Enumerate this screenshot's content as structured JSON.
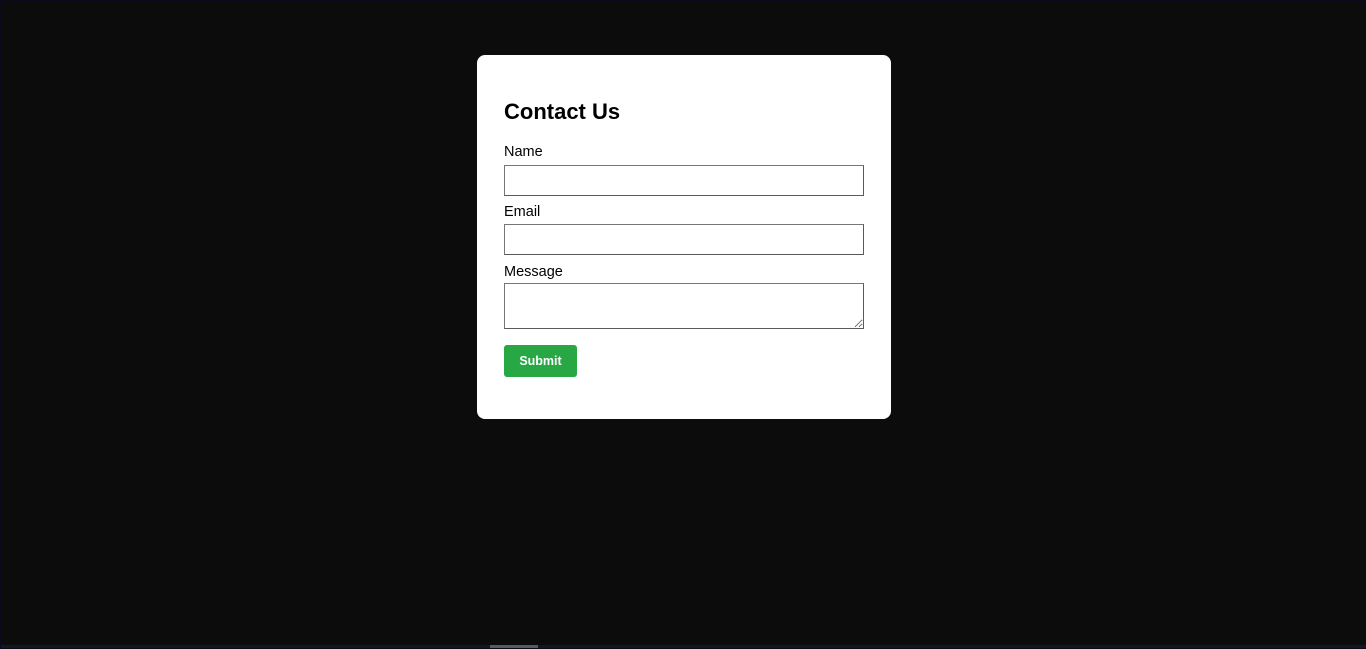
{
  "form": {
    "title": "Contact Us",
    "name_label": "Name",
    "name_value": "",
    "email_label": "Email",
    "email_value": "",
    "message_label": "Message",
    "message_value": "",
    "submit_label": "Submit"
  },
  "colors": {
    "page_background": "#0c0c0c",
    "card_background": "#ffffff",
    "submit_background": "#28a745",
    "submit_text": "#ffffff"
  }
}
